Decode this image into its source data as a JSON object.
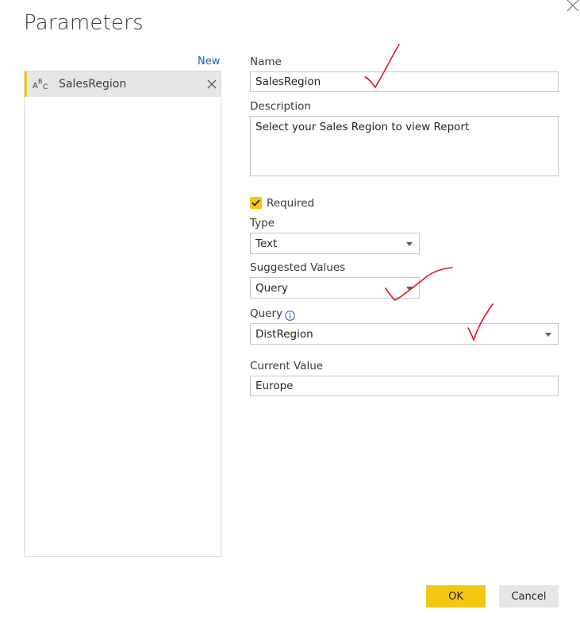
{
  "dialog": {
    "title": "Parameters",
    "new_label": "New",
    "parameters": [
      {
        "name": "SalesRegion",
        "type_icon": "abc-text-type-icon"
      }
    ]
  },
  "form": {
    "name_label": "Name",
    "name_value": "SalesRegion",
    "description_label": "Description",
    "description_value": "Select your Sales Region to view Report",
    "required_label": "Required",
    "required_checked": true,
    "type_label": "Type",
    "type_value": "Text",
    "suggested_label": "Suggested Values",
    "suggested_value": "Query",
    "query_label": "Query",
    "query_value": "DistRegion",
    "current_label": "Current Value",
    "current_value": "Europe"
  },
  "buttons": {
    "ok": "OK",
    "cancel": "Cancel"
  },
  "colors": {
    "accent": "#f2c811",
    "link": "#1b5ea8",
    "annotation": "#e81123"
  }
}
